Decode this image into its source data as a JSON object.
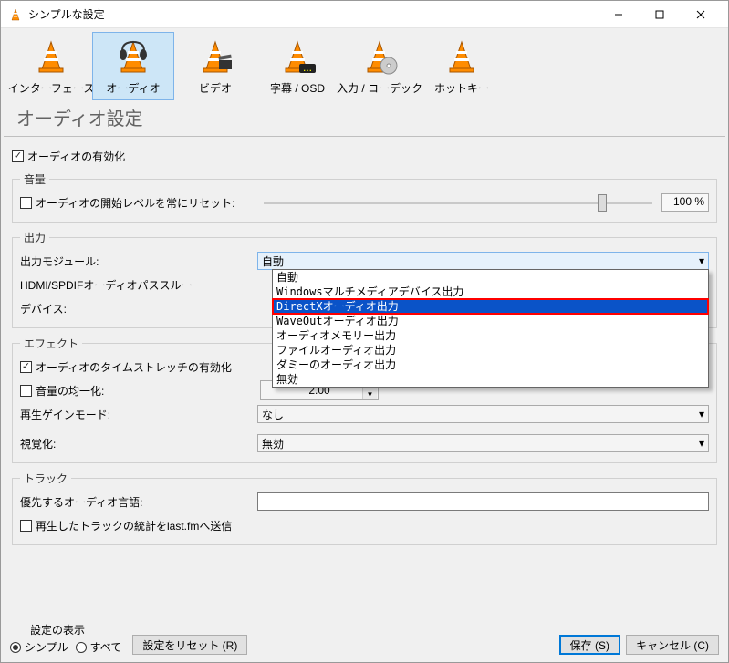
{
  "window": {
    "title": "シンプルな設定"
  },
  "toolbar": {
    "items": [
      {
        "label": "インターフェース"
      },
      {
        "label": "オーディオ"
      },
      {
        "label": "ビデオ"
      },
      {
        "label": "字幕 / OSD"
      },
      {
        "label": "入力 / コーデック"
      },
      {
        "label": "ホットキー"
      }
    ],
    "selected_index": 1
  },
  "page": {
    "heading": "オーディオ設定"
  },
  "checkboxes": {
    "enable_audio": "オーディオの有効化",
    "reset_level": "オーディオの開始レベルを常にリセット:",
    "timestretch": "オーディオのタイムストレッチの有効化",
    "norm": "音量の均一化:",
    "lastfm": "再生したトラックの統計をlast.fmへ送信"
  },
  "groups": {
    "volume": "音量",
    "output": "出力",
    "effects": "エフェクト",
    "tracks": "トラック"
  },
  "labels": {
    "output_module": "出力モジュール:",
    "hdmi": "HDMI/SPDIFオーディオパススルー",
    "device": "デバイス:",
    "gain_mode": "再生ゲインモード:",
    "visualization": "視覚化:",
    "pref_lang": "優先するオーディオ言語:"
  },
  "values": {
    "volume_pct": "100 %",
    "output_module": "自動",
    "spin": "2.00",
    "gain_mode": "なし",
    "visualization": "無効"
  },
  "dropdown": {
    "items": [
      "自動",
      "Windowsマルチメディアデバイス出力",
      "DirectXオーディオ出力",
      "WaveOutオーディオ出力",
      "オーディオメモリー出力",
      "ファイルオーディオ出力",
      "ダミーのオーディオ出力",
      "無効"
    ],
    "highlighted_index": 2
  },
  "footer": {
    "show_settings": "設定の表示",
    "simple": "シンプル",
    "all": "すべて",
    "reset": "設定をリセット (R)",
    "save": "保存 (S)",
    "cancel": "キャンセル (C)"
  }
}
